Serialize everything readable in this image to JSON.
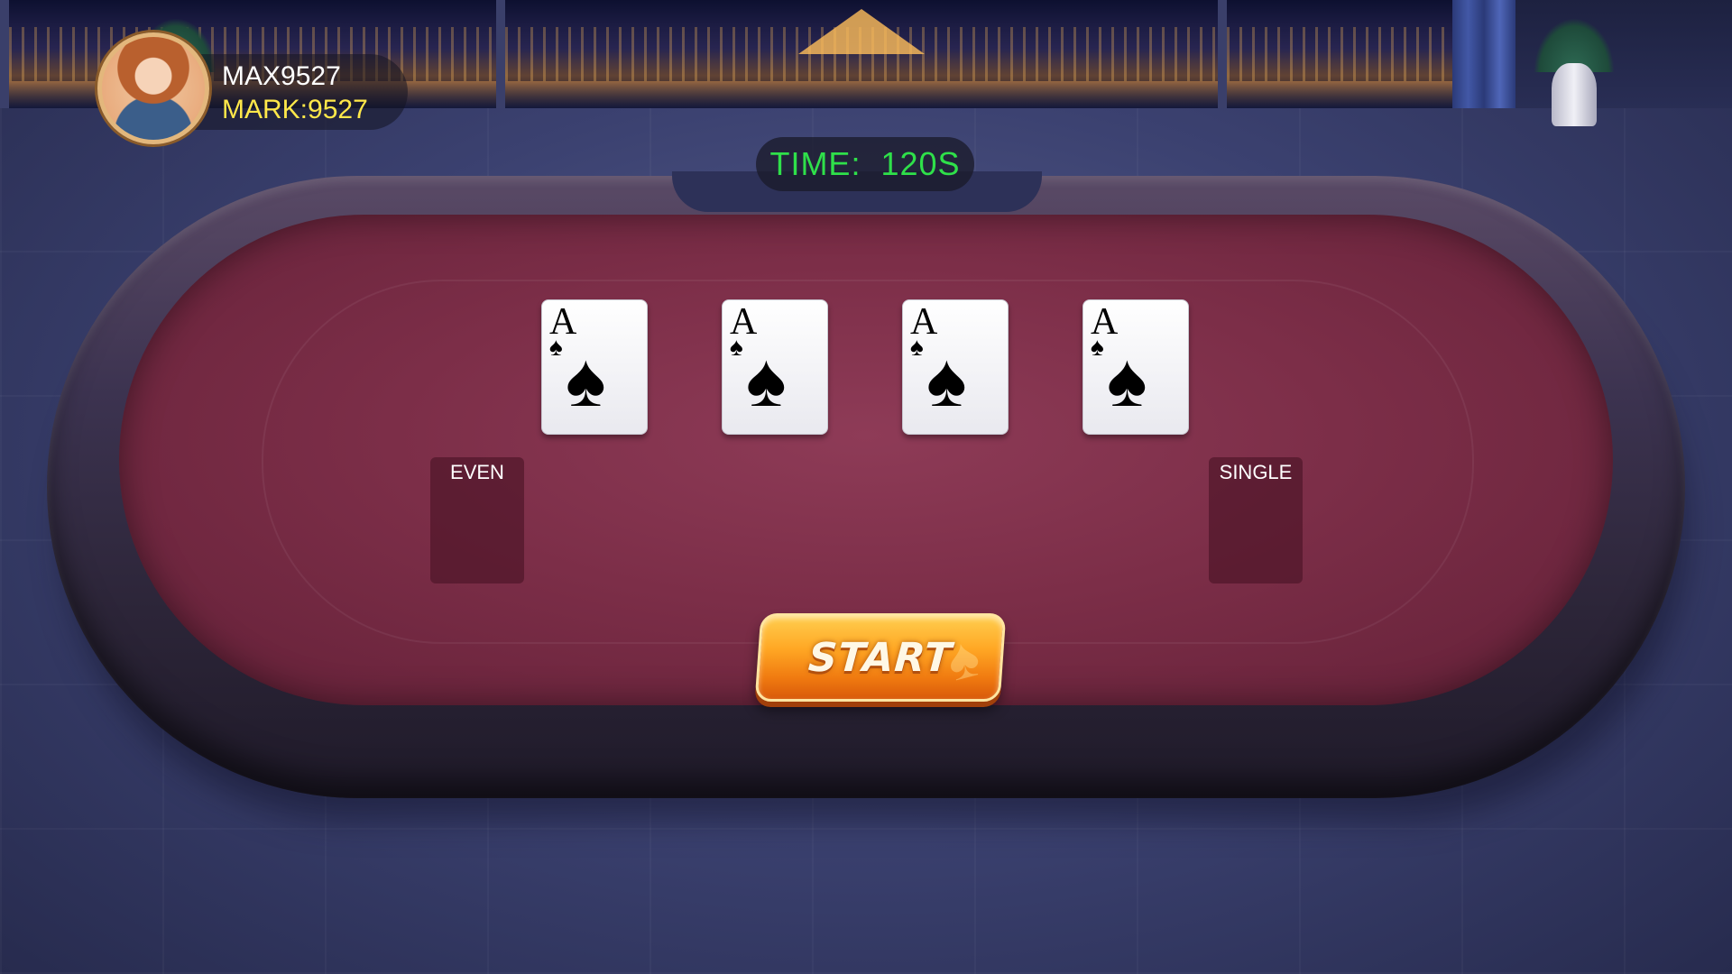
{
  "player": {
    "name": "MAX9527",
    "mark": "MARK:9527"
  },
  "timer": {
    "label": "TIME:  120S"
  },
  "cards": [
    {
      "rank": "A",
      "suit": "♠"
    },
    {
      "rank": "A",
      "suit": "♠"
    },
    {
      "rank": "A",
      "suit": "♠"
    },
    {
      "rank": "A",
      "suit": "♠"
    }
  ],
  "bets": {
    "even_label": "EVEN",
    "single_label": "SINGLE"
  },
  "controls": {
    "start_label": "START"
  },
  "colors": {
    "timer_text": "#2fe04a",
    "mark_text": "#ffe84a",
    "felt": "#7c2e48",
    "start_button": "#ffa724"
  }
}
